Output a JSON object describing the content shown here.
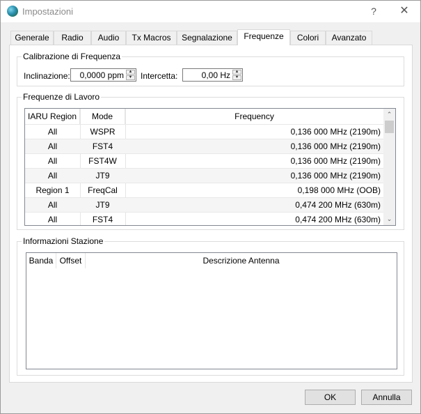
{
  "window": {
    "title": "Impostazioni",
    "help_label": "?",
    "close_label": "✕"
  },
  "tabs": [
    {
      "label": "Generale"
    },
    {
      "label": "Radio"
    },
    {
      "label": "Audio"
    },
    {
      "label": "Tx Macros"
    },
    {
      "label": "Segnalazione"
    },
    {
      "label": "Frequenze",
      "active": true
    },
    {
      "label": "Colori"
    },
    {
      "label": "Avanzato"
    }
  ],
  "calibration": {
    "title": "Calibrazione di Frequenza",
    "slope_label": "Inclinazione:",
    "slope_value": "0,0000 ppm",
    "intercept_label": "Intercetta:",
    "intercept_value": "0,00 Hz"
  },
  "working_frequencies": {
    "title": "Frequenze di Lavoro",
    "columns": [
      "IARU Region",
      "Mode",
      "Frequency"
    ],
    "rows": [
      {
        "region": "All",
        "mode": "WSPR",
        "frequency": "0,136 000 MHz (2190m)"
      },
      {
        "region": "All",
        "mode": "FST4",
        "frequency": "0,136 000 MHz (2190m)"
      },
      {
        "region": "All",
        "mode": "FST4W",
        "frequency": "0,136 000 MHz (2190m)"
      },
      {
        "region": "All",
        "mode": "JT9",
        "frequency": "0,136 000 MHz (2190m)"
      },
      {
        "region": "Region 1",
        "mode": "FreqCal",
        "frequency": "0,198 000 MHz (OOB)"
      },
      {
        "region": "All",
        "mode": "JT9",
        "frequency": "0,474 200 MHz (630m)"
      },
      {
        "region": "All",
        "mode": "FST4",
        "frequency": "0,474 200 MHz (630m)"
      }
    ],
    "sorted_column": "Frequency"
  },
  "station_info": {
    "title": "Informazioni Stazione",
    "columns": [
      "Banda",
      "Offset",
      "Descrizione Antenna"
    ],
    "sorted_column": "Banda"
  },
  "footer": {
    "ok_label": "OK",
    "cancel_label": "Annulla"
  },
  "icons": {
    "app": "globe-icon",
    "spin_up": "▲",
    "spin_down": "▼",
    "scroll_up": "⌃",
    "scroll_down": "⌄",
    "sort": "⌃"
  }
}
